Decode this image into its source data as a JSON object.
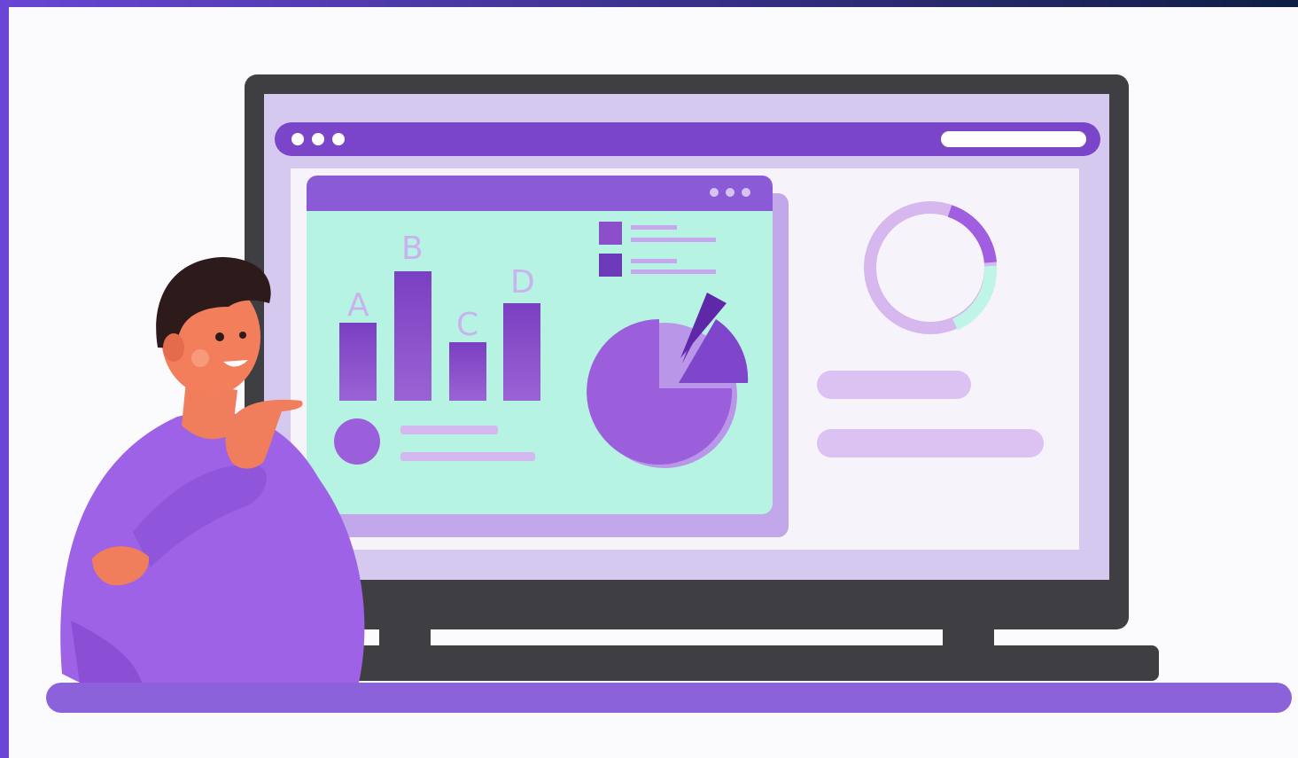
{
  "colors": {
    "page_background": "#fbfafc",
    "frame_gradient_start": "#6a45d6",
    "frame_gradient_end": "#0e1e45",
    "monitor_body": "#3f3f43",
    "screen_background": "#d6c9ef",
    "browser_bar": "#7b45c9",
    "chart_panel": "#b7f3e2",
    "chart_panel_header": "#8b5ad6",
    "bar_fill": "#8a4fc9",
    "pie_fill": "#9b5fdb",
    "donut_light": "#d6b7ee",
    "donut_accent": "#9f5fe0",
    "donut_mint": "#bff5e6",
    "placeholder_bar": "#dcc1f3",
    "character_sweater": "#9d62e6",
    "character_skin": "#f07d5b",
    "character_hair": "#2d1a1a",
    "desk": "#8c62db"
  },
  "icons": {
    "window_controls": "three-dots-icon",
    "legend_swatches": "legend-square-icon",
    "pie": "pie-chart-icon",
    "donut": "donut-chart-icon"
  },
  "bar_chart": {
    "labels": [
      "A",
      "B",
      "C",
      "D"
    ]
  }
}
